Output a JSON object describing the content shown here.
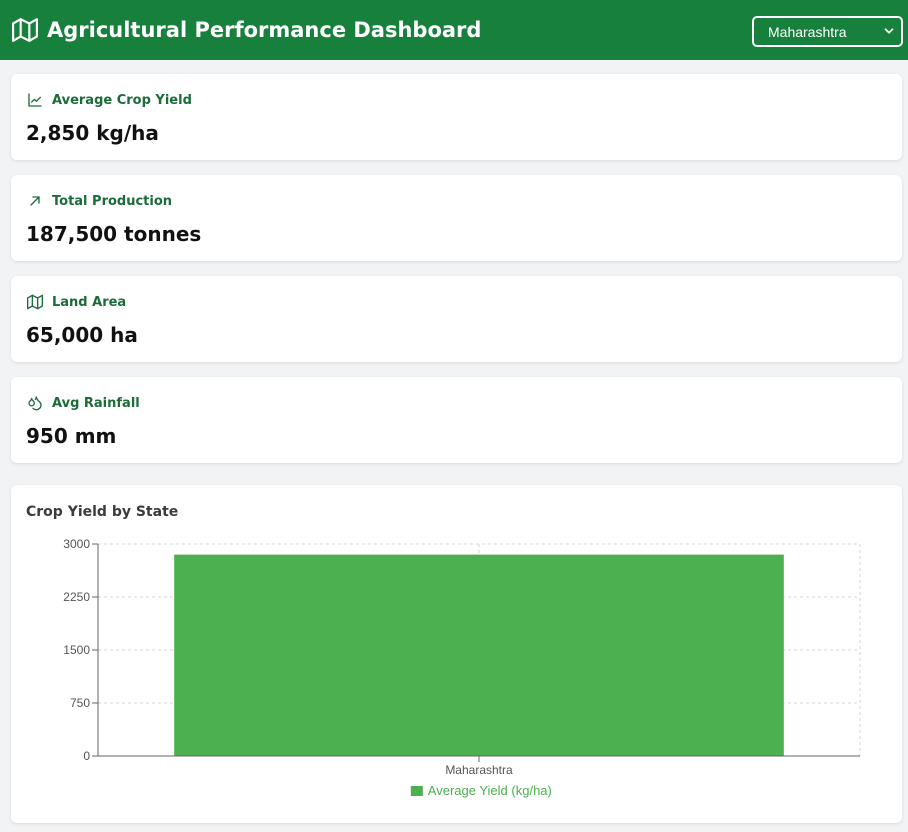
{
  "header": {
    "title": "Agricultural Performance Dashboard",
    "icon": "map-icon",
    "state_select": {
      "selected": "Maharashtra",
      "options": [
        "Maharashtra"
      ]
    }
  },
  "stats": [
    {
      "icon": "trend-line-icon",
      "label": "Average Crop Yield",
      "value": "2,850 kg/ha"
    },
    {
      "icon": "arrow-up-right-icon",
      "label": "Total Production",
      "value": "187,500 tonnes"
    },
    {
      "icon": "map-icon",
      "label": "Land Area",
      "value": "65,000 ha"
    },
    {
      "icon": "droplets-icon",
      "label": "Avg Rainfall",
      "value": "950 mm"
    }
  ],
  "colors": {
    "header_bg": "#16803c",
    "accent_text": "#1c6b3a",
    "bar": "#4caf50"
  },
  "chart_data": {
    "type": "bar",
    "title": "Crop Yield by State",
    "categories": [
      "Maharashtra"
    ],
    "series": [
      {
        "name": "Average Yield (kg/ha)",
        "values": [
          2850
        ]
      }
    ],
    "ylim": [
      0,
      3000
    ],
    "yticks": [
      0,
      750,
      1500,
      2250,
      3000
    ],
    "grid": true,
    "legend": "bottom"
  }
}
